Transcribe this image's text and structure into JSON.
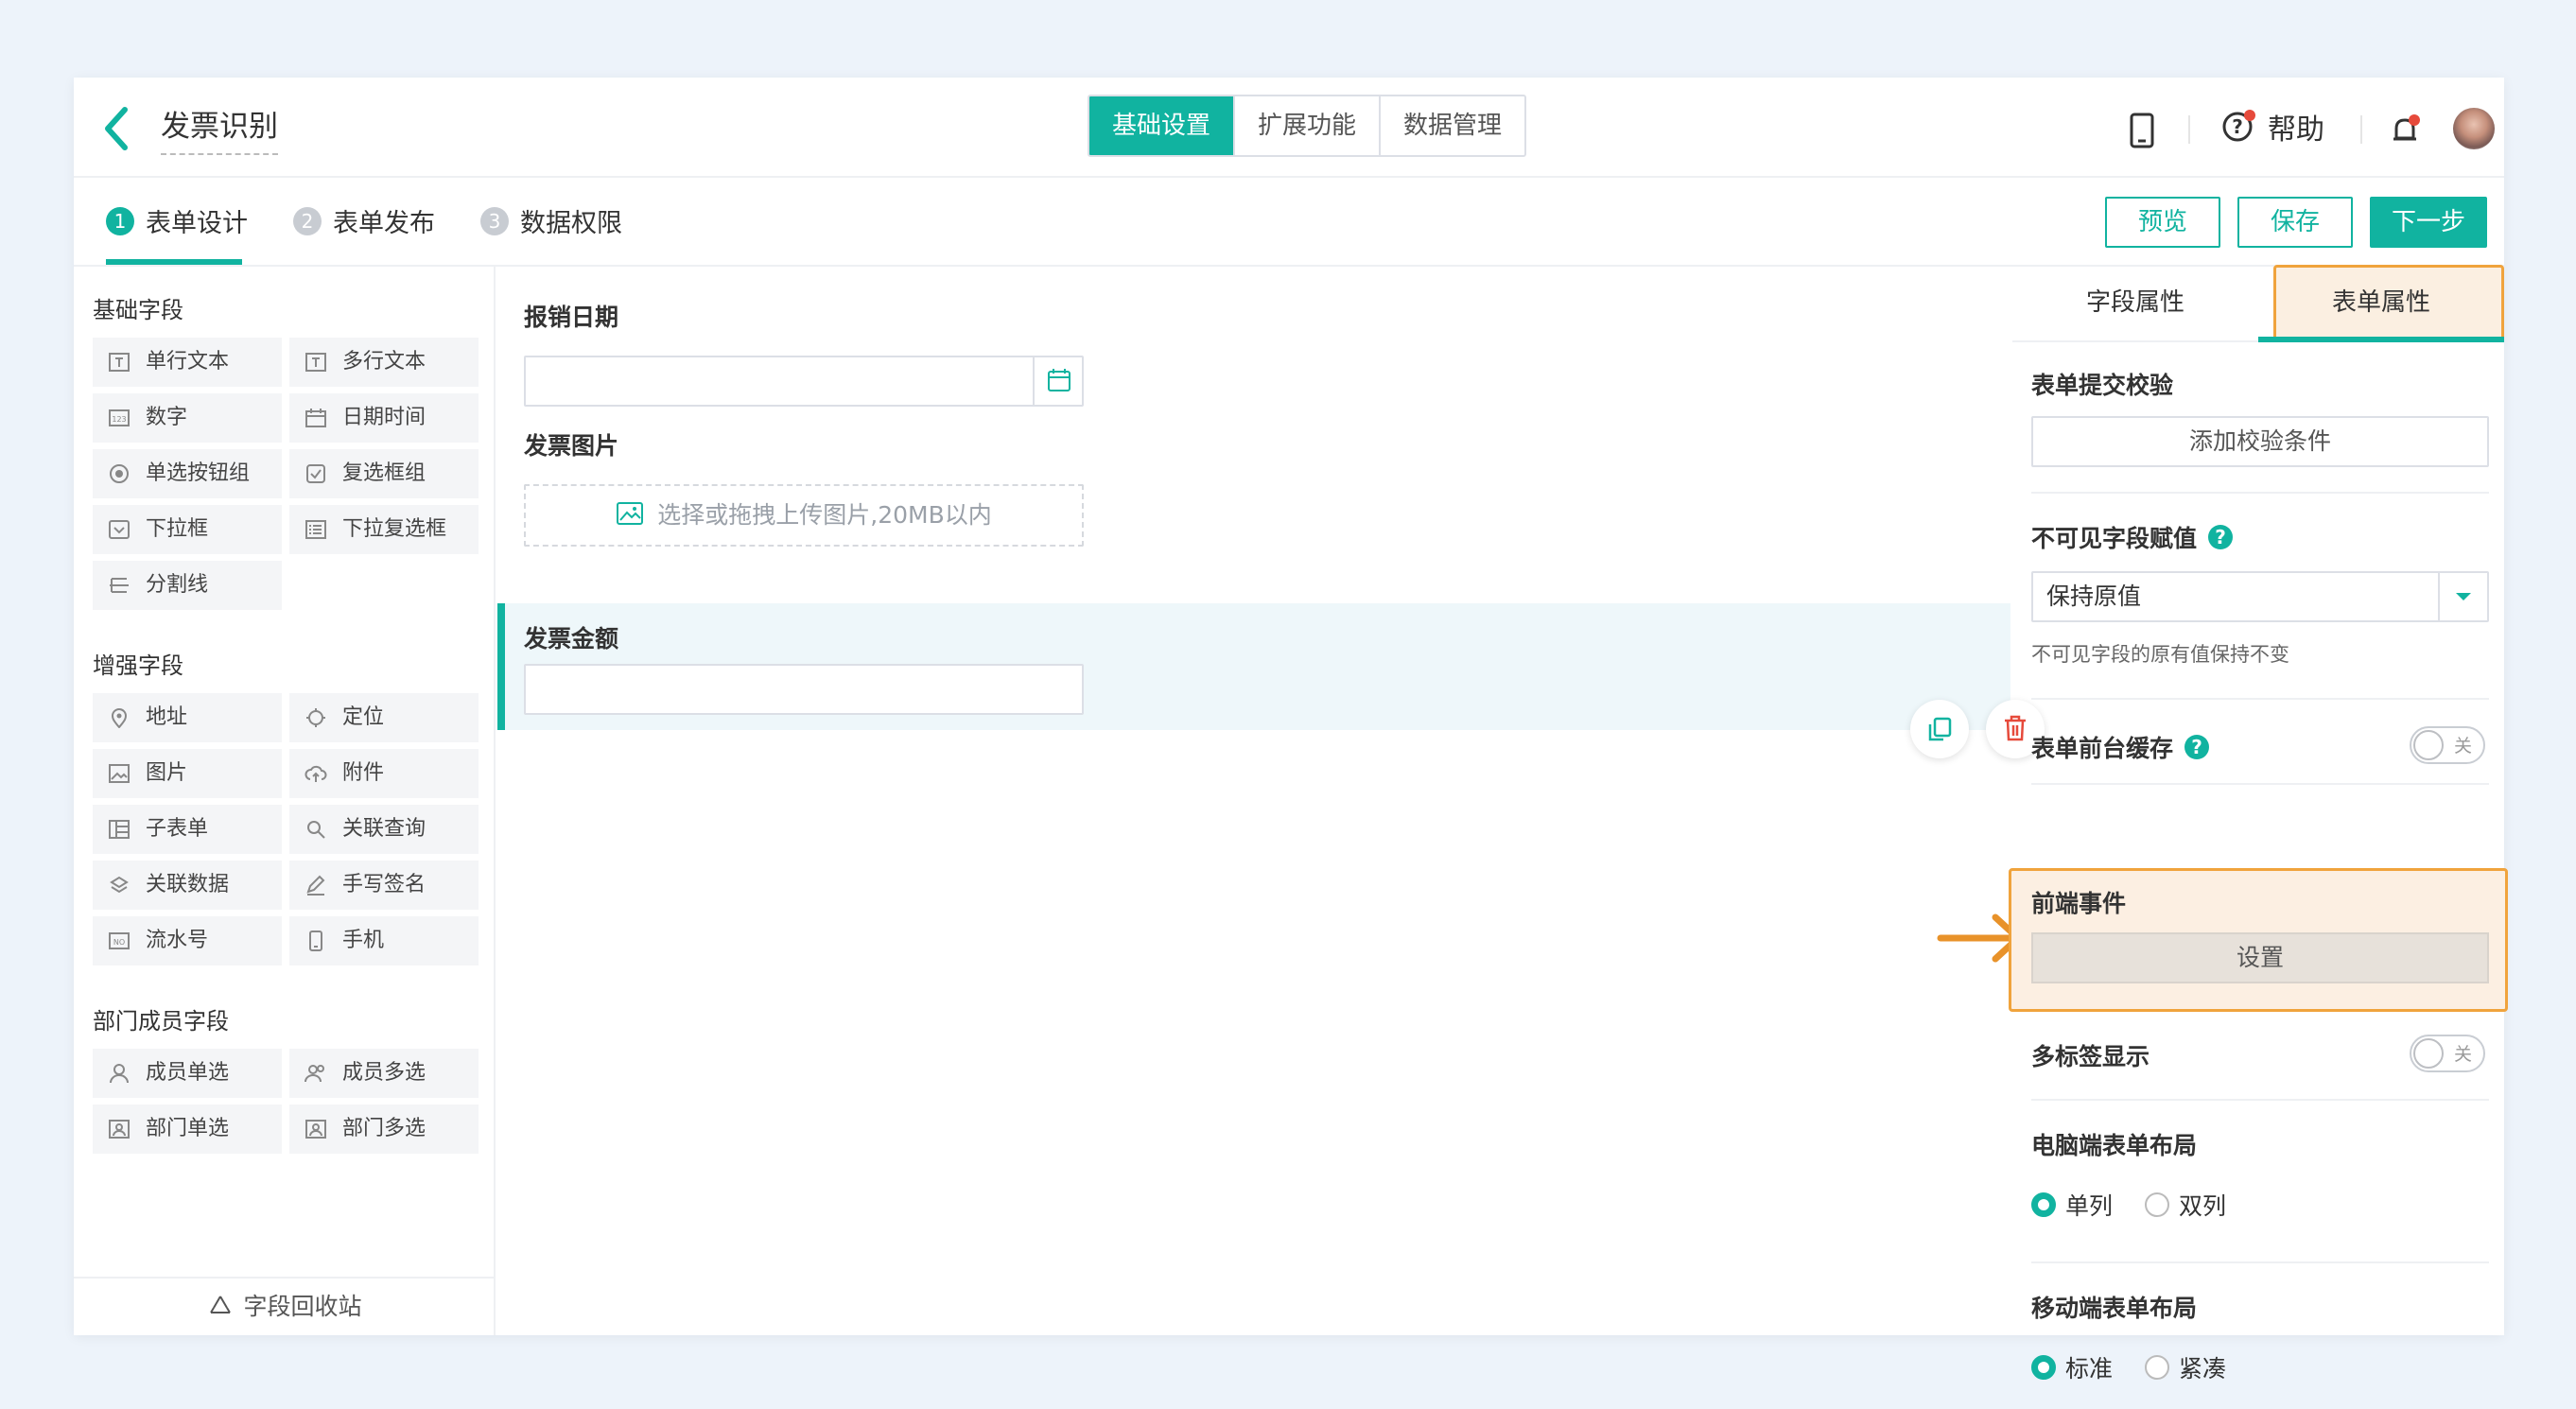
{
  "header": {
    "title": "发票识别",
    "seg_tabs": [
      "基础设置",
      "扩展功能",
      "数据管理"
    ],
    "help_label": "帮助"
  },
  "steps": [
    {
      "num": "1",
      "label": "表单设计"
    },
    {
      "num": "2",
      "label": "表单发布"
    },
    {
      "num": "3",
      "label": "数据权限"
    }
  ],
  "actions": {
    "preview": "预览",
    "save": "保存",
    "next": "下一步"
  },
  "left": {
    "basic_title": "基础字段",
    "basic": [
      "单行文本",
      "多行文本",
      "数字",
      "日期时间",
      "单选按钮组",
      "复选框组",
      "下拉框",
      "下拉复选框",
      "分割线"
    ],
    "enhanced_title": "增强字段",
    "enhanced": [
      "地址",
      "定位",
      "图片",
      "附件",
      "子表单",
      "关联查询",
      "关联数据",
      "手写签名",
      "流水号",
      "手机"
    ],
    "member_title": "部门成员字段",
    "member": [
      "成员单选",
      "成员多选",
      "部门单选",
      "部门多选"
    ],
    "recycle": "字段回收站"
  },
  "canvas": {
    "f1_label": "报销日期",
    "f2_label": "发票图片",
    "upload_hint": "选择或拖拽上传图片,20MB以内",
    "f3_label": "发票金额"
  },
  "right": {
    "tab_field": "字段属性",
    "tab_form": "表单属性",
    "submit_check": "表单提交校验",
    "add_check": "添加校验条件",
    "invisible": "不可见字段赋值",
    "invisible_value": "保持原值",
    "invisible_note": "不可见字段的原有值保持不变",
    "cache": "表单前台缓存",
    "toggle_off": "关",
    "events": "前端事件",
    "set": "设置",
    "multitab": "多标签显示",
    "pc_layout": "电脑端表单布局",
    "pc_opts": [
      "单列",
      "双列"
    ],
    "mobile_layout": "移动端表单布局",
    "mobile_opts": [
      "标准",
      "紧凑"
    ]
  },
  "colors": {
    "accent": "#11b3a0",
    "highlight": "#f0a33c"
  }
}
